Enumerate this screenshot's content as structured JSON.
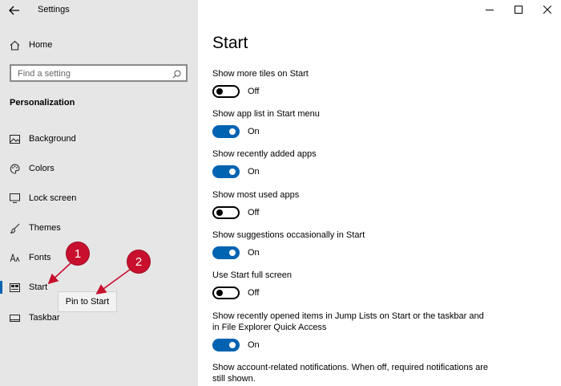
{
  "window": {
    "title": "Settings",
    "controls": [
      "minimize",
      "maximize",
      "close"
    ]
  },
  "sidebar": {
    "home_label": "Home",
    "search_placeholder": "Find a setting",
    "section": "Personalization",
    "items": [
      {
        "label": "Background",
        "icon": "picture-icon"
      },
      {
        "label": "Colors",
        "icon": "palette-icon"
      },
      {
        "label": "Lock screen",
        "icon": "monitor-icon"
      },
      {
        "label": "Themes",
        "icon": "brush-icon"
      },
      {
        "label": "Fonts",
        "icon": "font-icon"
      },
      {
        "label": "Start",
        "icon": "start-layout-icon",
        "selected": true
      },
      {
        "label": "Taskbar",
        "icon": "taskbar-icon"
      }
    ],
    "context_menu": {
      "label": "Pin to Start"
    }
  },
  "annotations": [
    {
      "number": "1"
    },
    {
      "number": "2"
    }
  ],
  "main": {
    "title": "Start",
    "settings": [
      {
        "label": "Show more tiles on Start",
        "state": "Off",
        "on": false
      },
      {
        "label": "Show app list in Start menu",
        "state": "On",
        "on": true
      },
      {
        "label": "Show recently added apps",
        "state": "On",
        "on": true
      },
      {
        "label": "Show most used apps",
        "state": "Off",
        "on": false
      },
      {
        "label": "Show suggestions occasionally in Start",
        "state": "On",
        "on": true
      },
      {
        "label": "Use Start full screen",
        "state": "Off",
        "on": false
      },
      {
        "label": "Show recently opened items in Jump Lists on Start or the taskbar and in File Explorer Quick Access",
        "state": "On",
        "on": true
      },
      {
        "label": "Show account-related notifications. When off, required notifications are still shown."
      }
    ]
  },
  "colors": {
    "accent": "#0063b1",
    "sidebar_bg": "#e6e6e6",
    "annotation": "#c8102e"
  }
}
